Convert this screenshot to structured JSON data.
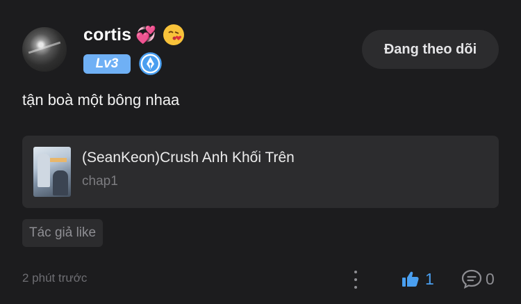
{
  "comment": {
    "user": {
      "name": "cortis",
      "emojis": [
        "💞",
        "😘"
      ],
      "level": "Lv3",
      "badge_icon": "pen-nib-icon"
    },
    "follow_label": "Đang theo dõi",
    "text": "tận boà một bông nhaa",
    "story": {
      "title": "(SeanKeon)Crush Anh Khối Trên",
      "chapter": "chap1",
      "cover_icon": "story-cover-image"
    },
    "tag": "Tác giả like",
    "timestamp": "2 phút trước",
    "likes": "1",
    "replies": "0"
  },
  "colors": {
    "background": "#1c1c1e",
    "card": "#2c2c2e",
    "accent_blue": "#4a9ff0",
    "level_badge": "#6fb0f5",
    "muted": "#8e8e93"
  }
}
